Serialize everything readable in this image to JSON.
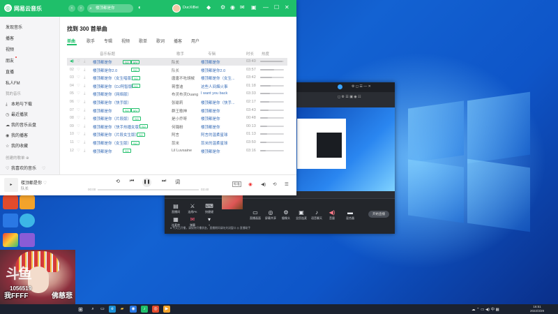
{
  "music_app": {
    "logo_glyph": "◎",
    "app_name": "网易云音乐",
    "search_query": "楼顶都是你",
    "username": "DucXiBei",
    "nav": {
      "back": "‹",
      "forward": "›"
    },
    "sidebar": {
      "items": [
        "发现音乐",
        "播客",
        "视频",
        "朋友",
        "直播",
        "私人FM"
      ],
      "my_music_label": "我的音乐",
      "my_music": [
        "本地与下载",
        "最近播放",
        "我的音乐云盘",
        "我的播客",
        "我的收藏"
      ],
      "created_label": "创建的歌单",
      "playlist": "我喜欢的音乐"
    },
    "result_title": "找到 300 首单曲",
    "tabs": [
      "单曲",
      "歌手",
      "专辑",
      "视频",
      "歌单",
      "歌词",
      "播客",
      "用户"
    ],
    "columns": {
      "title": "音乐标题",
      "artist": "歌手",
      "album": "专辑",
      "duration": "时长",
      "heat": "热度"
    },
    "songs": [
      {
        "num": "",
        "title": "楼顶都是你",
        "tags": [
          "SQ",
          "MV"
        ],
        "artist": "队长",
        "album": "楼顶都是你",
        "duration": "03:40",
        "heat": 0.95
      },
      {
        "num": "02",
        "title": "楼顶都是你2.0",
        "tags": [
          "SQ"
        ],
        "artist": "队长",
        "album": "楼顶都是你2.0",
        "duration": "03:57",
        "heat": 0.6
      },
      {
        "num": "03",
        "title": "楼顶都是你（女生唱版）",
        "tags": [
          "SQ"
        ],
        "artist": "唐唐不吃胡椒",
        "album": "楼顶都是你（女生...",
        "duration": "03:42",
        "heat": 0.5
      },
      {
        "num": "04",
        "title": "楼顶都是你（DJ阿智版）",
        "tags": [
          "SQ"
        ],
        "artist": "蒋雪迪",
        "album": "这些人间烟火事",
        "duration": "01:18",
        "heat": 0.45
      },
      {
        "num": "05",
        "title": "楼顶都是你（网络版）",
        "tags": [],
        "artist": "布灵布灵Duang",
        "album": "I want you back",
        "duration": "03:33",
        "heat": 0.4
      },
      {
        "num": "06",
        "title": "楼顶都是你（快手版）",
        "tags": [],
        "artist": "张瑜莉",
        "album": "楼顶都是你（快手...",
        "duration": "02:17",
        "heat": 0.38
      },
      {
        "num": "07",
        "title": "楼顶都是你",
        "tags": [
          "SQ",
          "MV"
        ],
        "artist": "群王歌神",
        "album": "楼顶都是你",
        "duration": "03:43",
        "heat": 0.35
      },
      {
        "num": "08",
        "title": "楼顶都是你（片段版）",
        "tags": [
          "SQ"
        ],
        "artist": "是小乔呀",
        "album": "楼顶都是你",
        "duration": "00:48",
        "heat": 0.32
      },
      {
        "num": "09",
        "title": "楼顶都是你（快手热播女版）",
        "tags": [
          "SQ"
        ],
        "artist": "何璐粉",
        "album": "楼顶都是你",
        "duration": "00:13",
        "heat": 0.3
      },
      {
        "num": "10",
        "title": "楼顶都是你（片段女生版）",
        "tags": [
          "SQ"
        ],
        "artist": "阿言",
        "album": "阿言的温柔星球",
        "duration": "01:13",
        "heat": 0.28
      },
      {
        "num": "11",
        "title": "楼顶都是你（女生版）",
        "tags": [
          "SQ"
        ],
        "artist": "蕊米",
        "album": "蕊米的温柔星球",
        "duration": "03:50",
        "heat": 0.26
      },
      {
        "num": "12",
        "title": "楼顶都是你",
        "tags": [
          "SQ"
        ],
        "artist": "Lil Luvsaine",
        "album": "楼顶都是你",
        "duration": "03:16",
        "heat": 0.24
      }
    ],
    "player": {
      "title": "楼顶都是你",
      "artist": "队长",
      "elapsed": "00:00",
      "total": "03:40",
      "quality": "标准",
      "progress": 0.0
    }
  },
  "streaming_app": {
    "buttons_row1": [
      "直播间",
      "连线PK",
      "快捷键"
    ],
    "buttons_row2": [
      "连麦房",
      "弹幕",
      "+"
    ],
    "controls": [
      "直播画面",
      "屏幕共享",
      "摄像头",
      "全民连麦",
      "语音聊天",
      "音量",
      "混合器"
    ],
    "go_live": "开始直播",
    "status": "● 今天已开播，请保持开播状态，直播期间请勿关闭窗口    ◎ 直播助手"
  },
  "webcam": {
    "brand": "斗鱼",
    "room_id": "1056519",
    "left_text": "我FFFF",
    "right_text": "佛慈悲"
  },
  "taskbar": {
    "clock_time": "16:51",
    "clock_date": "2022/3/29"
  },
  "colors": {
    "accent": "#1fbf6a",
    "link": "#3b6fb8"
  }
}
